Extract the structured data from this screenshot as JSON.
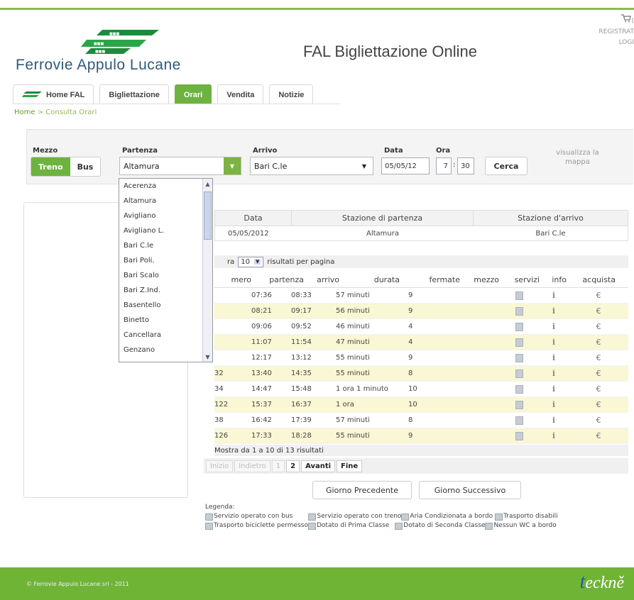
{
  "header": {
    "logo_text": "Ferrovie Appulo Lucane",
    "site_title": "FAL Bigliettazione Online",
    "cart_label": "(",
    "register_label": "REGISTRAT",
    "login_label": "LOGI"
  },
  "nav": {
    "tabs": [
      {
        "label": "Home FAL"
      },
      {
        "label": "Bigliettazione"
      },
      {
        "label": "Orari"
      },
      {
        "label": "Vendita"
      },
      {
        "label": "Notizie"
      }
    ],
    "active": "Orari"
  },
  "breadcrumb": {
    "home": "Home",
    "separator": ">",
    "current": "Consulta Orari"
  },
  "search": {
    "mezzo_label": "Mezzo",
    "mezzo_options": [
      "Treno",
      "Bus"
    ],
    "mezzo_selected": "Treno",
    "partenza_label": "Partenza",
    "partenza_value": "Altamura",
    "arrivo_label": "Arrivo",
    "arrivo_value": "Bari C.le",
    "data_label": "Data",
    "data_value": "05/05/12",
    "ora_label": "Ora",
    "ora_hour": "7",
    "ora_sep": ":",
    "ora_min": "30",
    "cerca_label": "Cerca",
    "map_link": "visualizza la mappa"
  },
  "dropdown": {
    "items": [
      "Acerenza",
      "Altamura",
      "Avigliano",
      "Avigliano L.",
      "Bari C.le",
      "Bari Poli.",
      "Bari Scalo",
      "Bari Z.Ind.",
      "Basentello",
      "Binetto",
      "Cancellara",
      "Genzano"
    ]
  },
  "summary": {
    "headers": [
      "Data",
      "Stazione di partenza",
      "Stazione d'arrivo"
    ],
    "row": [
      "05/05/2012",
      "Altamura",
      "Bari C.le"
    ]
  },
  "results": {
    "per_page_prefix": "ra",
    "per_page_value": "10",
    "per_page_suffix": "risultati per pagina",
    "headers": [
      "mero",
      "partenza",
      "arrivo",
      "durata",
      "fermate",
      "mezzo",
      "servizi",
      "info",
      "acquista"
    ],
    "rows": [
      {
        "numero": "",
        "partenza": "07:36",
        "arrivo": "08:33",
        "durata": "57 minuti",
        "fermate": "9"
      },
      {
        "numero": "",
        "partenza": "08:21",
        "arrivo": "09:17",
        "durata": "56 minuti",
        "fermate": "9"
      },
      {
        "numero": "",
        "partenza": "09:06",
        "arrivo": "09:52",
        "durata": "46 minuti",
        "fermate": "4"
      },
      {
        "numero": "",
        "partenza": "11:07",
        "arrivo": "11:54",
        "durata": "47 minuti",
        "fermate": "4"
      },
      {
        "numero": "",
        "partenza": "12:17",
        "arrivo": "13:12",
        "durata": "55 minuti",
        "fermate": "9"
      },
      {
        "numero": "32",
        "partenza": "13:40",
        "arrivo": "14:35",
        "durata": "55 minuti",
        "fermate": "8"
      },
      {
        "numero": "34",
        "partenza": "14:47",
        "arrivo": "15:48",
        "durata": "1 ora 1 minuto",
        "fermate": "10"
      },
      {
        "numero": "122",
        "partenza": "15:37",
        "arrivo": "16:37",
        "durata": "1 ora",
        "fermate": "10"
      },
      {
        "numero": "38",
        "partenza": "16:42",
        "arrivo": "17:39",
        "durata": "57 minuti",
        "fermate": "8"
      },
      {
        "numero": "126",
        "partenza": "17:33",
        "arrivo": "18:28",
        "durata": "55 minuti",
        "fermate": "9"
      }
    ],
    "status": "Mostra da 1 a 10 di 13 risultati",
    "pager": [
      "Inizio",
      "Indietro",
      "1",
      "2",
      "Avanti",
      "Fine"
    ],
    "prev_day": "Giorno Precedente",
    "next_day": "Giorno Successivo"
  },
  "legend": {
    "title": "Legenda:",
    "row1": [
      "Servizio operato con bus",
      "Servizio operato con treno",
      "Aria Condizionata a bordo",
      "Trasporto disabili"
    ],
    "row2": [
      "Trasporto biciclette permesso",
      "Dotato di Prima Classe",
      "Dotato di Seconda Classe",
      "Nessun WC a bordo"
    ]
  },
  "footer": {
    "copyright": "© Ferrovie Appulo Lucane srl - 2011",
    "brand_first": "t",
    "brand_rest": "eckně"
  },
  "colors": {
    "accent_green": "#6db33f",
    "footer_green": "#70b436",
    "row_highlight": "#f9f7d4",
    "logo_blue": "#2f5a7a"
  }
}
